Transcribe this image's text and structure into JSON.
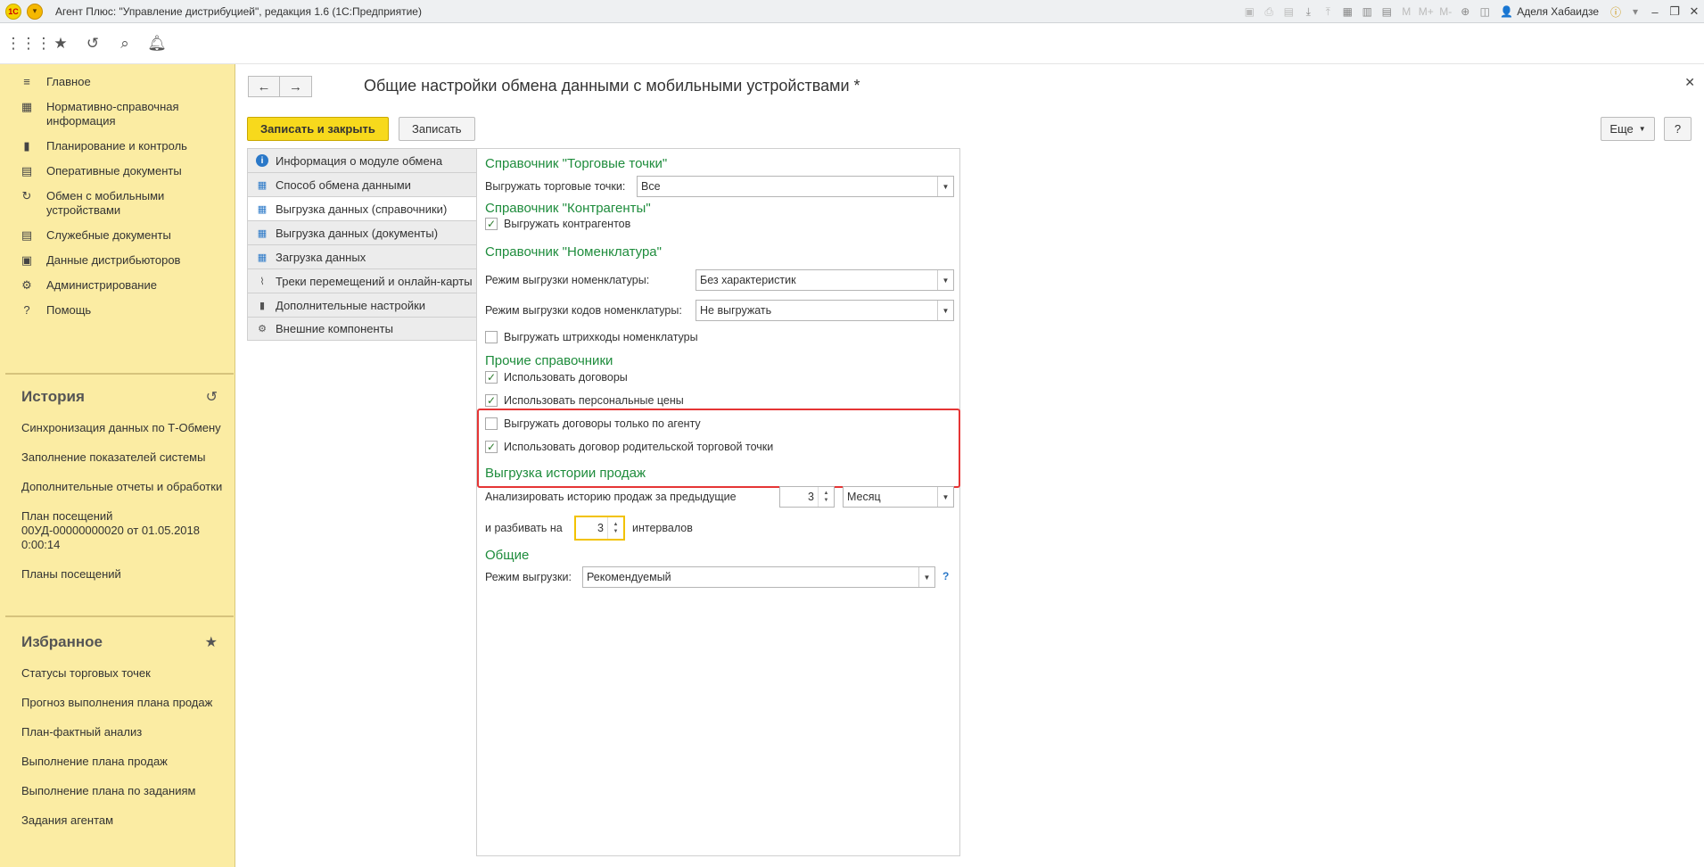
{
  "titlebar": {
    "title": "Агент Плюс: \"Управление дистрибуцией\", редакция 1.6  (1С:Предприятие)",
    "user": "Аделя Хабаидзе",
    "logo_text": "1С"
  },
  "sidebar": {
    "items": [
      {
        "icon": "≡",
        "label": "Главное"
      },
      {
        "icon": "▦",
        "label": "Нормативно-справочная информация"
      },
      {
        "icon": "▮",
        "label": "Планирование и контроль"
      },
      {
        "icon": "▤",
        "label": "Оперативные документы"
      },
      {
        "icon": "↻",
        "label": "Обмен с мобильными устройствами"
      },
      {
        "icon": "▤",
        "label": "Служебные документы"
      },
      {
        "icon": "▣",
        "label": "Данные дистрибьюторов"
      },
      {
        "icon": "⚙",
        "label": "Администрирование"
      },
      {
        "icon": "?",
        "label": "Помощь"
      }
    ],
    "history": {
      "title": "История",
      "links": [
        "Синхронизация данных по Т-Обмену",
        "Заполнение показателей системы",
        "Дополнительные отчеты и обработки",
        "План посещений 00УД-00000000020 от 01.05.2018 0:00:14",
        "Планы посещений"
      ]
    },
    "favorites": {
      "title": "Избранное",
      "links": [
        "Статусы торговых точек",
        "Прогноз выполнения плана продаж",
        "План-фактный анализ",
        "Выполнение плана продаж",
        "Выполнение плана по заданиям",
        "Задания агентам"
      ]
    }
  },
  "main": {
    "title": "Общие настройки обмена данными с мобильными устройствами *",
    "save_close": "Записать и закрыть",
    "save": "Записать",
    "more": "Еще",
    "help": "?",
    "tabs": [
      {
        "label": "Информация о модуле обмена",
        "icon": "i"
      },
      {
        "label": "Способ обмена данными",
        "icon": "▦"
      },
      {
        "label": "Выгрузка данных (справочники)",
        "icon": "▦"
      },
      {
        "label": "Выгрузка данных (документы)",
        "icon": "▦"
      },
      {
        "label": "Загрузка данных",
        "icon": "▦"
      },
      {
        "label": "Треки перемещений и онлайн-карты",
        "icon": "⌇"
      },
      {
        "label": "Дополнительные настройки",
        "icon": "▮"
      },
      {
        "label": "Внешние компоненты",
        "icon": "⚙"
      }
    ]
  },
  "form": {
    "s1_title": "Справочник \"Торговые точки\"",
    "s1_label": "Выгружать торговые точки:",
    "s1_value": "Все",
    "s2_title": "Справочник \"Контрагенты\"",
    "s2_chk": "Выгружать контрагентов",
    "s3_title": "Справочник \"Номенклатура\"",
    "s3_mode_label": "Режим выгрузки номенклатуры:",
    "s3_mode_value": "Без характеристик",
    "s3_codes_label": "Режим выгрузки кодов номенклатуры:",
    "s3_codes_value": "Не выгружать",
    "s3_chk": "Выгружать штрихкоды номенклатуры",
    "s4_title": "Прочие справочники",
    "s4_chk1": "Использовать договоры",
    "s4_chk2": "Использовать персональные цены",
    "s4_chk3": "Выгружать договоры только по агенту",
    "s4_chk4": "Использовать договор родительской торговой точки",
    "s5_title": "Выгрузка истории продаж",
    "s5_label": "Анализировать историю продаж за предыдущие",
    "s5_count": "3",
    "s5_period": "Месяц",
    "s5_split_label": "и разбивать на",
    "s5_split_value": "3",
    "s5_intervals": "интервалов",
    "s6_title": "Общие",
    "s6_label": "Режим выгрузки:",
    "s6_value": "Рекомендуемый",
    "check_mark": "✓"
  }
}
